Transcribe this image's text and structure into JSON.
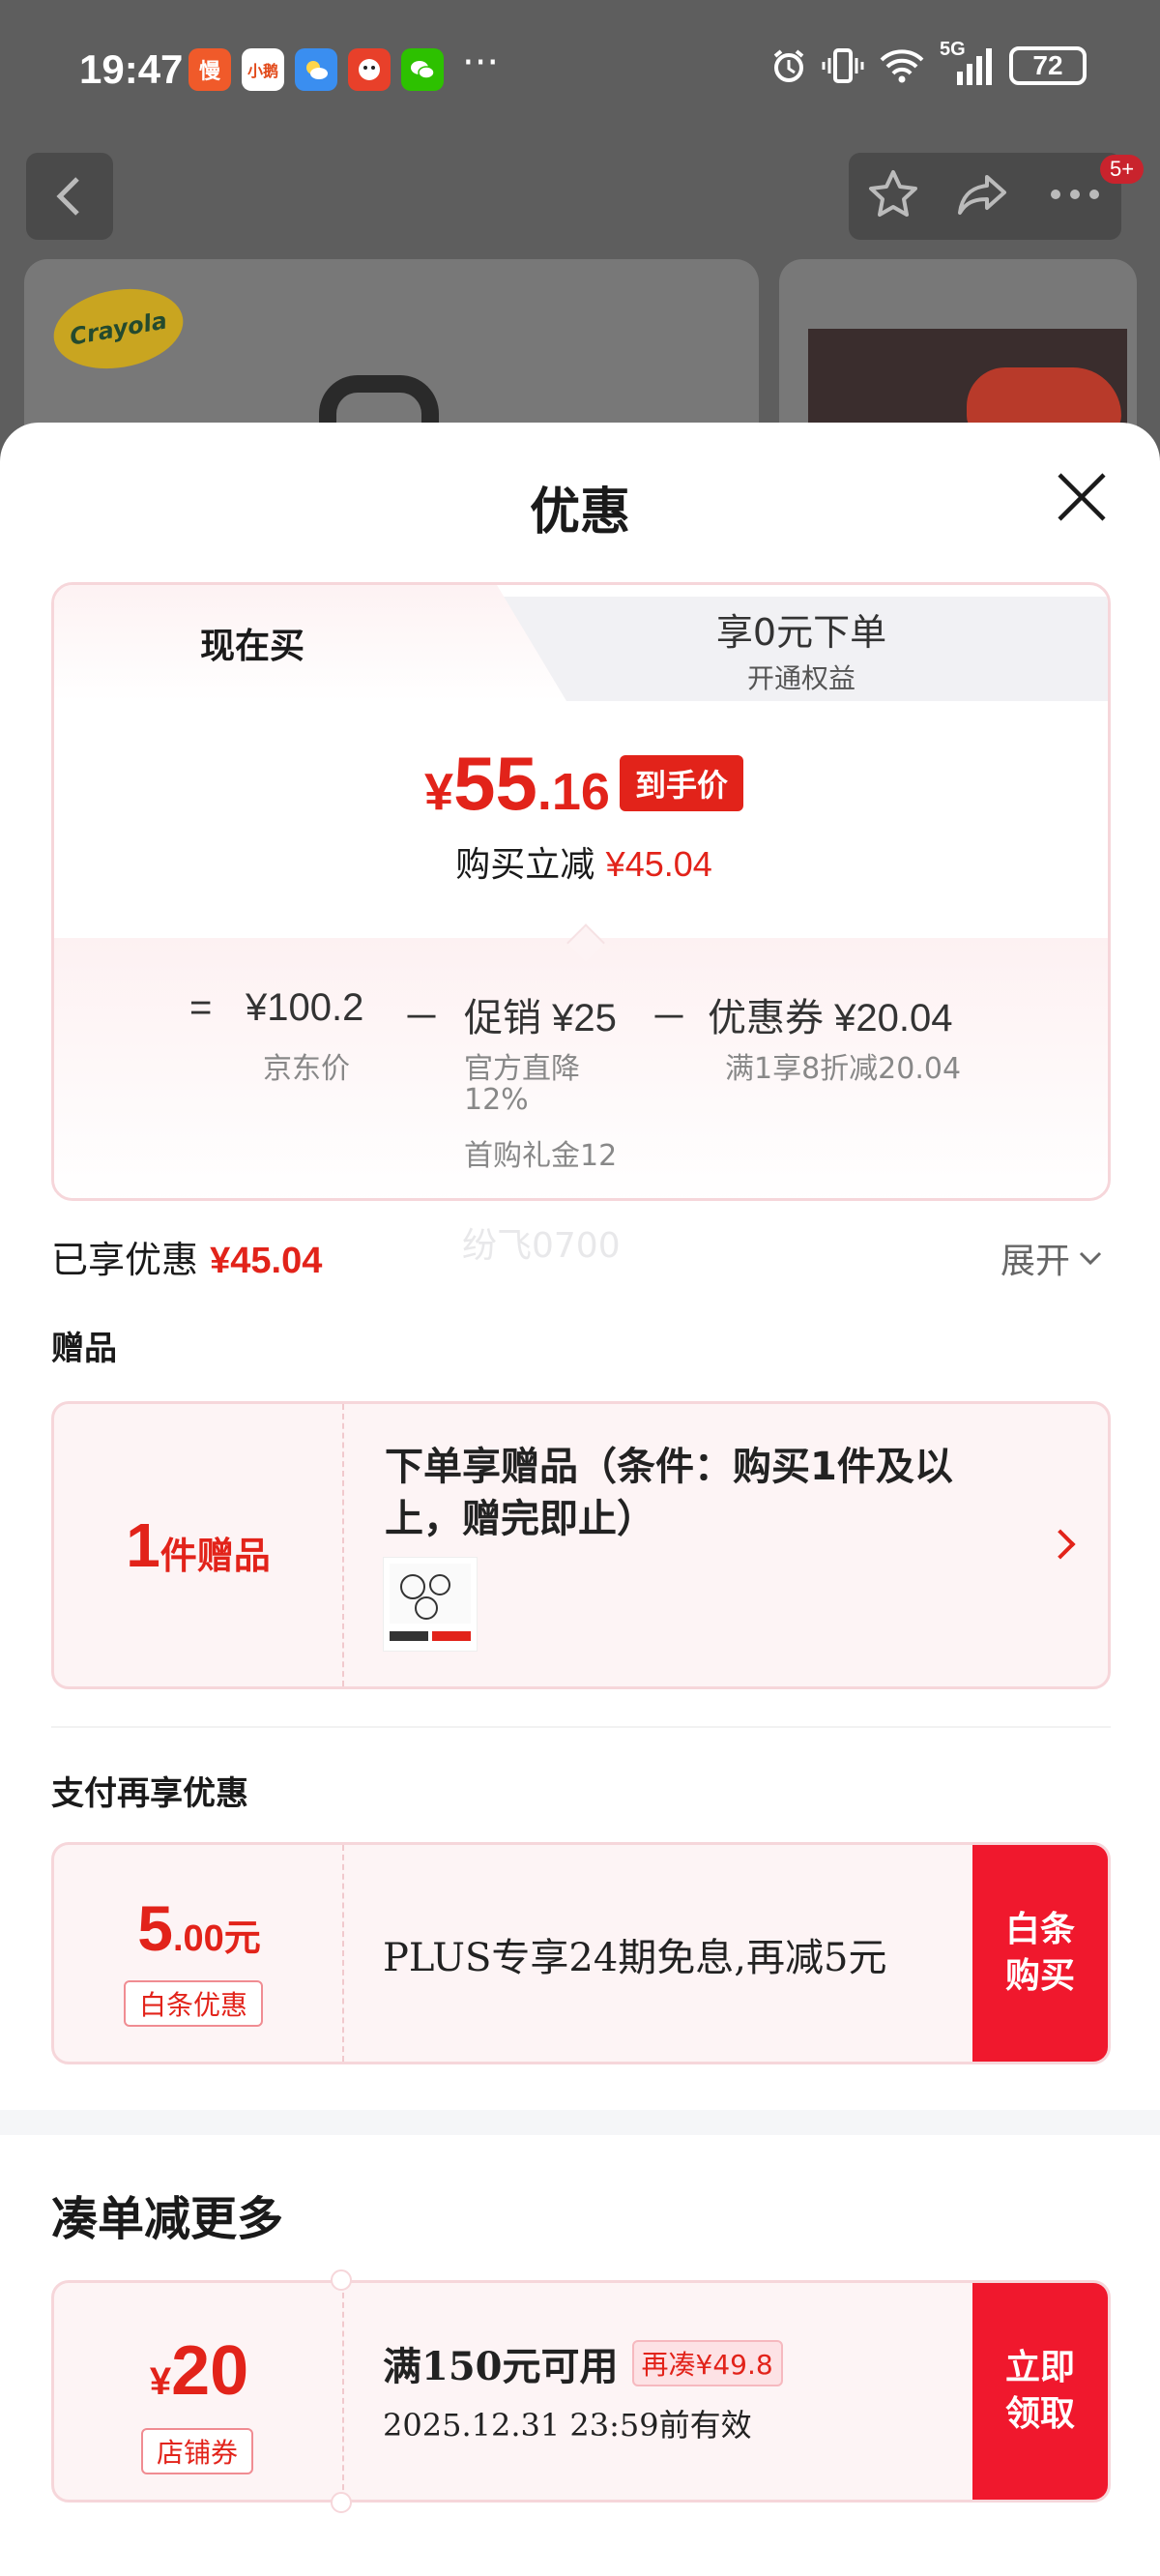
{
  "status_bar": {
    "time": "19:47",
    "apps": [
      {
        "name": "slow-app-icon",
        "label": "慢",
        "color": "#f05a2a"
      },
      {
        "name": "xiaohongshu-icon",
        "label": "小鹅",
        "color": "#ffffff"
      },
      {
        "name": "weather-icon",
        "label": "",
        "color": "#3a8ef0"
      },
      {
        "name": "game-app-icon",
        "label": "",
        "color": "#e8402a"
      },
      {
        "name": "wechat-icon",
        "label": "",
        "color": "#2dc100"
      }
    ],
    "more": "···",
    "network": "5G",
    "battery": "72"
  },
  "nav": {
    "badge": "5+"
  },
  "background_product": {
    "brand_logo": "Crayola"
  },
  "sheet": {
    "title": "优惠",
    "tabs": {
      "active": "现在买",
      "inactive_title": "享0元下单",
      "inactive_sub": "开通权益"
    },
    "final_price": {
      "symbol": "¥",
      "integer": "55",
      "decimal": ".16",
      "tag": "到手价"
    },
    "discount_line": {
      "label": "购买立减",
      "amount": "¥45.04"
    },
    "breakdown": {
      "equals": "=",
      "jd_price": "¥100.2",
      "jd_price_label": "京东价",
      "minus1": "－",
      "promo": "促销 ¥25",
      "promo_detail1": "官方直降",
      "promo_detail1b": "12%",
      "promo_detail2": "首购礼金12",
      "minus2": "－",
      "coupon": "优惠券 ¥20.04",
      "coupon_detail": "满1享8折减20.04"
    },
    "enjoyed": {
      "label": "已享优惠",
      "amount": "¥45.04",
      "watermark": "纷飞0700",
      "expand": "展开"
    },
    "gift": {
      "section": "赠品",
      "count": "1",
      "unit": "件赠品",
      "text": "下单享赠品（条件：购买1件及以上，赠完即止）"
    },
    "payment": {
      "section": "支付再享优惠",
      "amount_int": "5",
      "amount_rest": ".00元",
      "tag": "白条优惠",
      "text": "PLUS专享24期免息,再减5元",
      "button_line1": "白条",
      "button_line2": "购买"
    },
    "more": {
      "title": "凑单减更多",
      "coupon_symbol": "¥",
      "coupon_value": "20",
      "coupon_tag": "店铺券",
      "condition": "满150元可用",
      "condition_tag": "再凑¥49.8",
      "validity": "2025.12.31 23:59前有效",
      "button_line1": "立即",
      "button_line2": "领取"
    }
  },
  "colors": {
    "accent_red": "#e2231a",
    "button_red": "#f0182d",
    "card_border": "#f6d6da"
  }
}
